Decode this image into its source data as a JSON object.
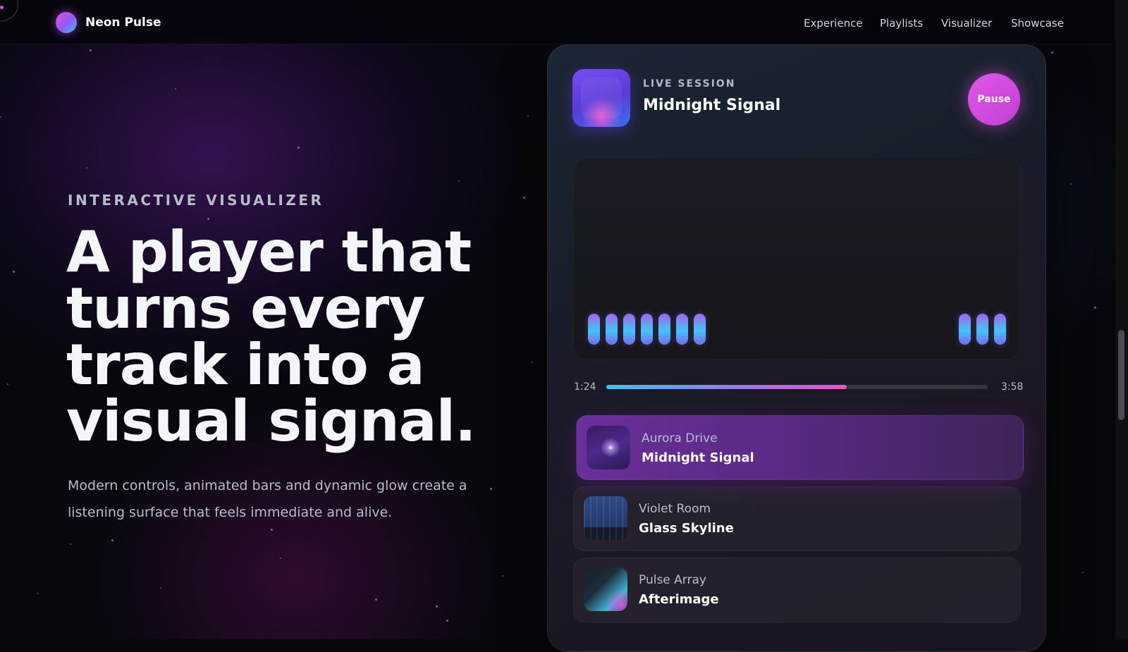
{
  "brand": {
    "name": "Neon Pulse"
  },
  "nav": {
    "items": [
      {
        "label": "Experience"
      },
      {
        "label": "Playlists"
      },
      {
        "label": "Visualizer"
      },
      {
        "label": "Showcase"
      }
    ]
  },
  "hero": {
    "eyebrow": "INTERACTIVE VISUALIZER",
    "headline": "A player that turns every track into a visual signal.",
    "subtitle": "Modern controls, animated bars and dynamic glow create a listening surface that feels immediate and alive."
  },
  "player": {
    "session_label": "LIVE SESSION",
    "now_playing_title": "Midnight Signal",
    "pause_label": "Pause",
    "elapsed": "1:24",
    "duration": "3:58",
    "progress": 0.63,
    "accent_colors": {
      "cyan": "#3ec1f4",
      "magenta": "#e157e6",
      "purple": "#8e5cf5"
    }
  },
  "playlist": [
    {
      "artist": "Aurora Drive",
      "title": "Midnight Signal",
      "active": true
    },
    {
      "artist": "Violet Room",
      "title": "Glass Skyline",
      "active": false
    },
    {
      "artist": "Pulse Array",
      "title": "Afterimage",
      "active": false
    }
  ]
}
